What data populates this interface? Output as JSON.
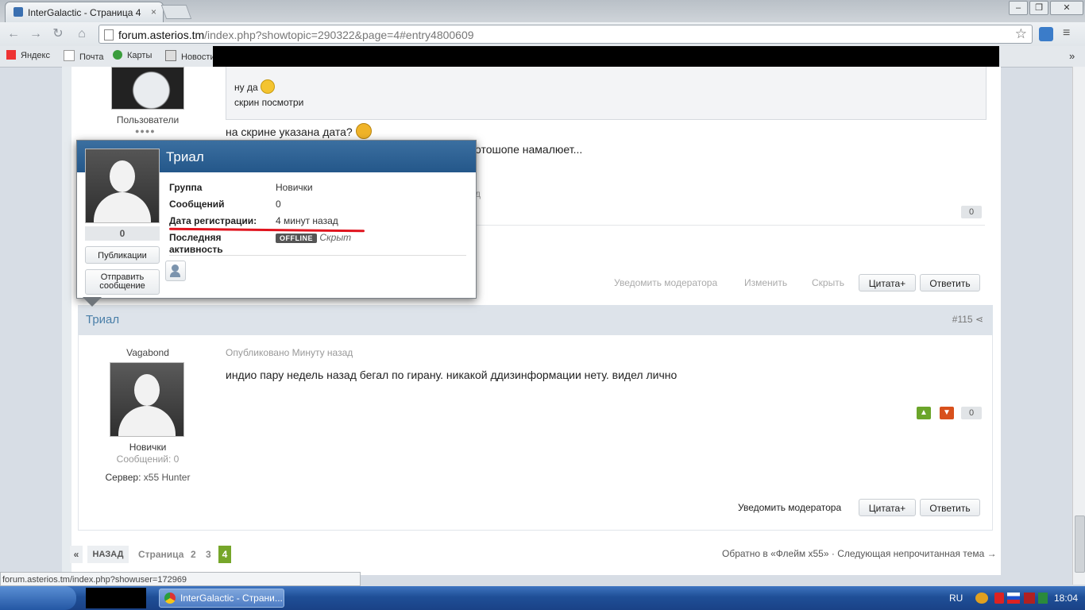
{
  "browser": {
    "tab_title": "InterGalactic - Страница 4",
    "tab_close": "×",
    "url_host": "forum.asterios.tm",
    "url_path": "/index.php?showtopic=290322&page=4#entry4800609",
    "star_glyph": "☆",
    "window_minimize": "‒",
    "window_maximize": "❐",
    "window_close": "✕",
    "bookmarks": [
      "Яндекс",
      "Почта",
      "Карты",
      "Новости"
    ],
    "bookmarks_overflow": "»"
  },
  "prev_post": {
    "author_group": "Пользователи",
    "quote_line1": "ну да",
    "quote_line2": "скрин посмотри",
    "text1": "на скрине указана дата?",
    "text2_fragment": "отошопе намалюет...",
    "text3_fragment": "д",
    "rep": "0",
    "actions": [
      "Уведомить модератора",
      "Изменить",
      "Скрыть"
    ],
    "quote_btn": "Цитата+",
    "reply_btn": "Ответить"
  },
  "popup": {
    "name": "Триал",
    "rep": "0",
    "publications_btn": "Публикации",
    "send_message_btn": "Отправить сообщение",
    "rows": [
      {
        "key": "Группа",
        "value": "Новички"
      },
      {
        "key": "Сообщений",
        "value": "0"
      },
      {
        "key": "Дата регистрации:",
        "value": "4 минут назад"
      },
      {
        "key": "Последняя активность",
        "value": "Скрыт"
      }
    ],
    "status_badge": "OFFLINE",
    "underline_color": "#e0141e"
  },
  "post": {
    "title": "Триал",
    "number": "#115",
    "author_title": "Vagabond",
    "group": "Новички",
    "posts_count": "Сообщений: 0",
    "server_label": "Сервер:",
    "server_value": "x55 Hunter",
    "published": "Опубликовано Минуту назад",
    "body": "индио пару недель назад бегал по гирану. никакой ддизинформации нету. видел лично",
    "rep": "0",
    "report_btn": "Уведомить модератора",
    "quote_btn": "Цитата+",
    "reply_btn": "Ответить",
    "vote_up_color": "#6ba52a",
    "vote_down_color": "#d8501c"
  },
  "pagination": {
    "first": "«",
    "back": "НАЗАД",
    "label": "Страница",
    "pages": [
      "2",
      "3"
    ],
    "current": "4",
    "back_to_forum": "Обратно в «Флейм x55»",
    "separator": "·",
    "next_unread": "Следующая непрочитанная тема →"
  },
  "statusbar": {
    "url": "forum.asterios.tm/index.php?showuser=172969"
  },
  "taskbar": {
    "task_title": "InterGalactic - Страни...",
    "lang": "RU",
    "time": "18:04"
  }
}
